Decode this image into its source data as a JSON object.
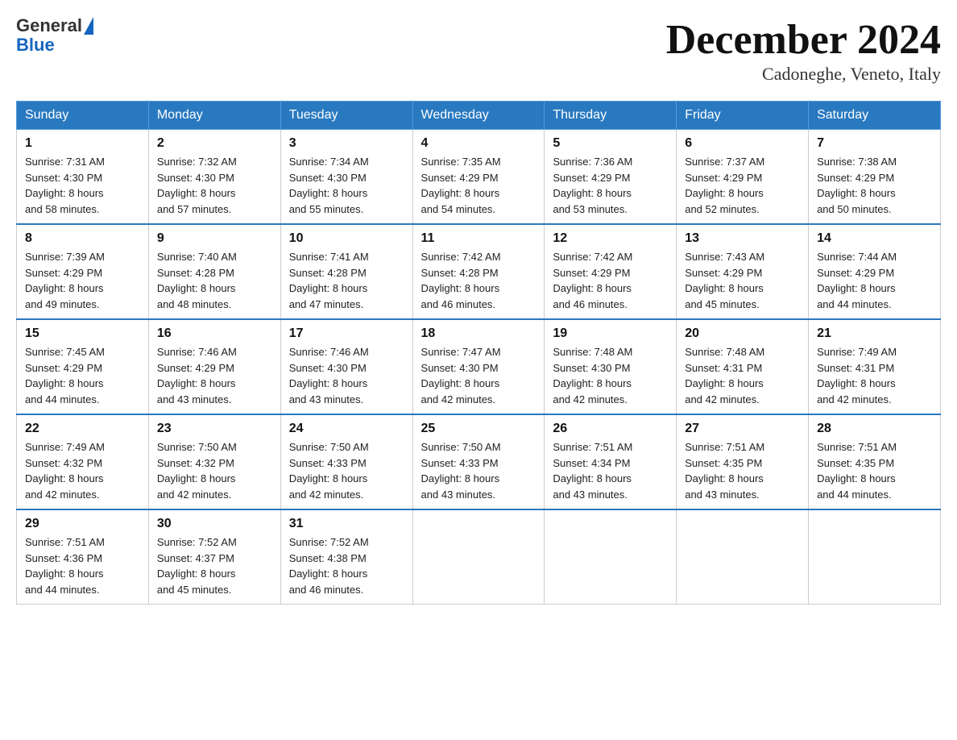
{
  "header": {
    "logo_general": "General",
    "logo_blue": "Blue",
    "month_title": "December 2024",
    "location": "Cadoneghe, Veneto, Italy"
  },
  "weekdays": [
    "Sunday",
    "Monday",
    "Tuesday",
    "Wednesday",
    "Thursday",
    "Friday",
    "Saturday"
  ],
  "weeks": [
    [
      {
        "day": "1",
        "sunrise": "7:31 AM",
        "sunset": "4:30 PM",
        "daylight": "8 hours and 58 minutes."
      },
      {
        "day": "2",
        "sunrise": "7:32 AM",
        "sunset": "4:30 PM",
        "daylight": "8 hours and 57 minutes."
      },
      {
        "day": "3",
        "sunrise": "7:34 AM",
        "sunset": "4:30 PM",
        "daylight": "8 hours and 55 minutes."
      },
      {
        "day": "4",
        "sunrise": "7:35 AM",
        "sunset": "4:29 PM",
        "daylight": "8 hours and 54 minutes."
      },
      {
        "day": "5",
        "sunrise": "7:36 AM",
        "sunset": "4:29 PM",
        "daylight": "8 hours and 53 minutes."
      },
      {
        "day": "6",
        "sunrise": "7:37 AM",
        "sunset": "4:29 PM",
        "daylight": "8 hours and 52 minutes."
      },
      {
        "day": "7",
        "sunrise": "7:38 AM",
        "sunset": "4:29 PM",
        "daylight": "8 hours and 50 minutes."
      }
    ],
    [
      {
        "day": "8",
        "sunrise": "7:39 AM",
        "sunset": "4:29 PM",
        "daylight": "8 hours and 49 minutes."
      },
      {
        "day": "9",
        "sunrise": "7:40 AM",
        "sunset": "4:28 PM",
        "daylight": "8 hours and 48 minutes."
      },
      {
        "day": "10",
        "sunrise": "7:41 AM",
        "sunset": "4:28 PM",
        "daylight": "8 hours and 47 minutes."
      },
      {
        "day": "11",
        "sunrise": "7:42 AM",
        "sunset": "4:28 PM",
        "daylight": "8 hours and 46 minutes."
      },
      {
        "day": "12",
        "sunrise": "7:42 AM",
        "sunset": "4:29 PM",
        "daylight": "8 hours and 46 minutes."
      },
      {
        "day": "13",
        "sunrise": "7:43 AM",
        "sunset": "4:29 PM",
        "daylight": "8 hours and 45 minutes."
      },
      {
        "day": "14",
        "sunrise": "7:44 AM",
        "sunset": "4:29 PM",
        "daylight": "8 hours and 44 minutes."
      }
    ],
    [
      {
        "day": "15",
        "sunrise": "7:45 AM",
        "sunset": "4:29 PM",
        "daylight": "8 hours and 44 minutes."
      },
      {
        "day": "16",
        "sunrise": "7:46 AM",
        "sunset": "4:29 PM",
        "daylight": "8 hours and 43 minutes."
      },
      {
        "day": "17",
        "sunrise": "7:46 AM",
        "sunset": "4:30 PM",
        "daylight": "8 hours and 43 minutes."
      },
      {
        "day": "18",
        "sunrise": "7:47 AM",
        "sunset": "4:30 PM",
        "daylight": "8 hours and 42 minutes."
      },
      {
        "day": "19",
        "sunrise": "7:48 AM",
        "sunset": "4:30 PM",
        "daylight": "8 hours and 42 minutes."
      },
      {
        "day": "20",
        "sunrise": "7:48 AM",
        "sunset": "4:31 PM",
        "daylight": "8 hours and 42 minutes."
      },
      {
        "day": "21",
        "sunrise": "7:49 AM",
        "sunset": "4:31 PM",
        "daylight": "8 hours and 42 minutes."
      }
    ],
    [
      {
        "day": "22",
        "sunrise": "7:49 AM",
        "sunset": "4:32 PM",
        "daylight": "8 hours and 42 minutes."
      },
      {
        "day": "23",
        "sunrise": "7:50 AM",
        "sunset": "4:32 PM",
        "daylight": "8 hours and 42 minutes."
      },
      {
        "day": "24",
        "sunrise": "7:50 AM",
        "sunset": "4:33 PM",
        "daylight": "8 hours and 42 minutes."
      },
      {
        "day": "25",
        "sunrise": "7:50 AM",
        "sunset": "4:33 PM",
        "daylight": "8 hours and 43 minutes."
      },
      {
        "day": "26",
        "sunrise": "7:51 AM",
        "sunset": "4:34 PM",
        "daylight": "8 hours and 43 minutes."
      },
      {
        "day": "27",
        "sunrise": "7:51 AM",
        "sunset": "4:35 PM",
        "daylight": "8 hours and 43 minutes."
      },
      {
        "day": "28",
        "sunrise": "7:51 AM",
        "sunset": "4:35 PM",
        "daylight": "8 hours and 44 minutes."
      }
    ],
    [
      {
        "day": "29",
        "sunrise": "7:51 AM",
        "sunset": "4:36 PM",
        "daylight": "8 hours and 44 minutes."
      },
      {
        "day": "30",
        "sunrise": "7:52 AM",
        "sunset": "4:37 PM",
        "daylight": "8 hours and 45 minutes."
      },
      {
        "day": "31",
        "sunrise": "7:52 AM",
        "sunset": "4:38 PM",
        "daylight": "8 hours and 46 minutes."
      },
      null,
      null,
      null,
      null
    ]
  ],
  "labels": {
    "sunrise": "Sunrise:",
    "sunset": "Sunset:",
    "daylight": "Daylight:"
  }
}
